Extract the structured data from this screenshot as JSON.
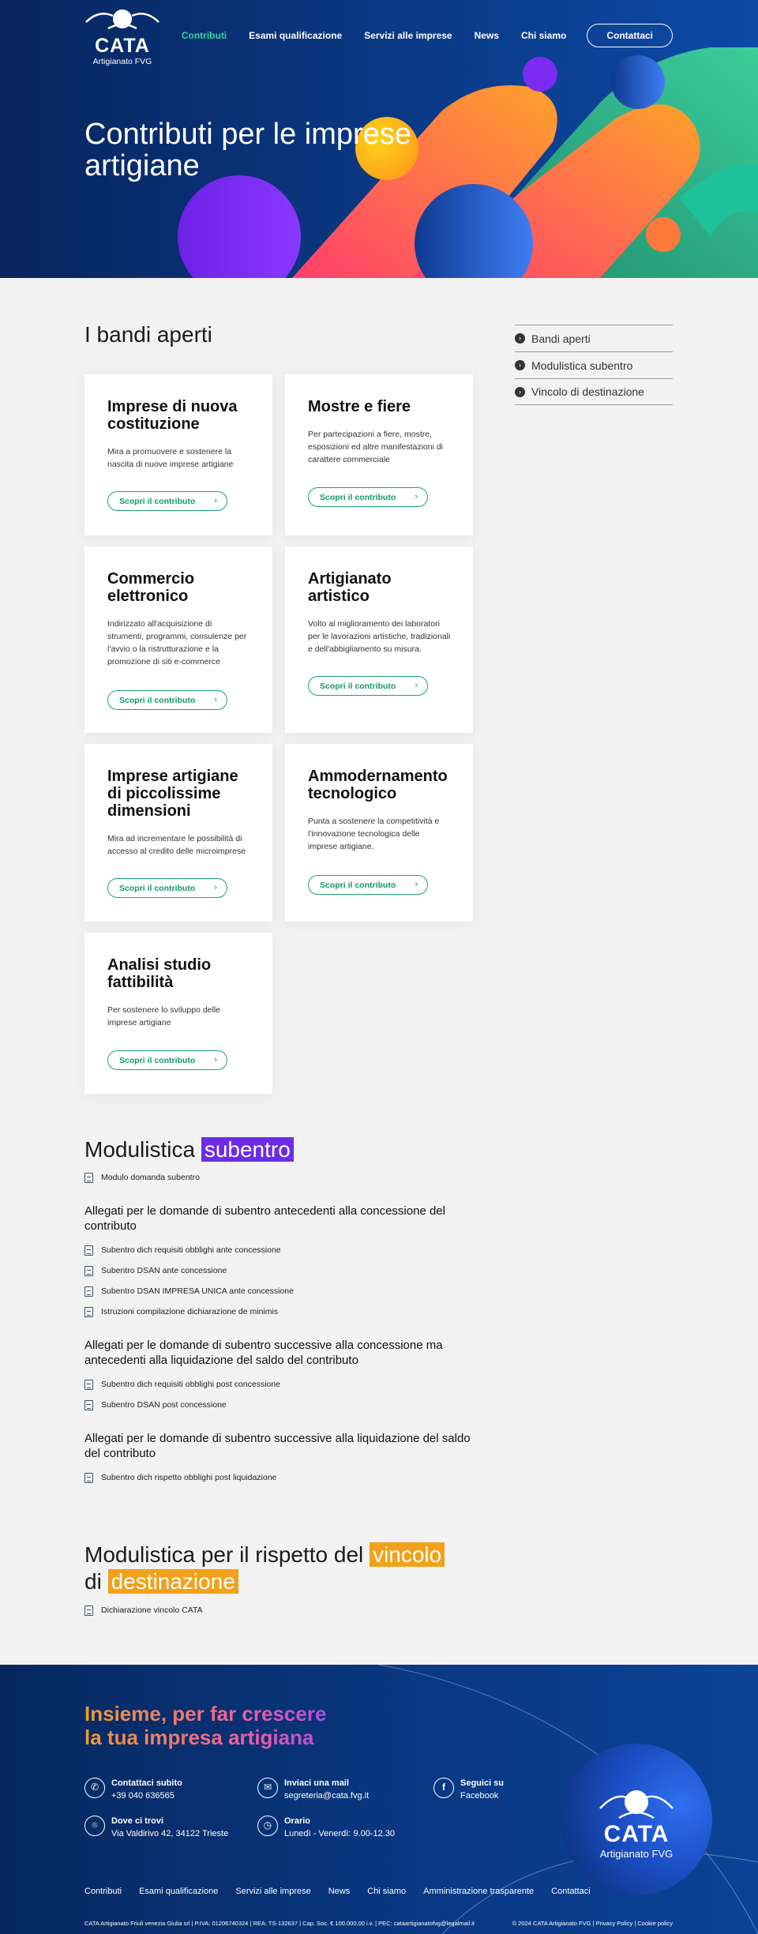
{
  "brand": {
    "name": "CATA",
    "sub": "Artigianato FVG"
  },
  "nav": {
    "items": [
      {
        "label": "Contributi"
      },
      {
        "label": "Esami qualificazione"
      },
      {
        "label": "Servizi alle imprese"
      },
      {
        "label": "News"
      },
      {
        "label": "Chi siamo"
      }
    ],
    "cta": "Contattaci",
    "accent": "#33d6a2"
  },
  "hero": {
    "title": "Contributi per le imprese artigiane"
  },
  "bandi": {
    "title": "I bandi aperti",
    "button": "Scopri il contributo",
    "cards": [
      {
        "title": "Imprese di nuova costituzione",
        "desc": "Mira a promuovere e sostenere la nascita di nuove imprese artigiane"
      },
      {
        "title": "Mostre e fiere",
        "desc": "Per partecipazioni a fiere, mostre, esposizioni ed altre manifestazioni di carattere commerciale"
      },
      {
        "title": "Commercio elettronico",
        "desc": "Indirizzato all'acquisizione di strumenti, programmi, consulenze per l'avvio o la ristrutturazione e la promozione di siti e-commerce"
      },
      {
        "title": "Artigianato artistico",
        "desc": "Volto al miglioramento dei laboratori per le lavorazioni artistiche, tradizionali e dell'abbigliamento su misura."
      },
      {
        "title": "Imprese artigiane di piccolissime dimensioni",
        "desc": "Mira ad incrementare le possibilità di accesso al credito delle microimprese"
      },
      {
        "title": "Ammodernamento tecnologico",
        "desc": "Punta a sostenere la competitività e l'innovazione tecnologica delle imprese artigiane."
      },
      {
        "title": "Analisi studio fattibilità",
        "desc": "Per sostenere lo sviluppo delle imprese artigiane"
      }
    ]
  },
  "sidebar": {
    "items": [
      {
        "label": "Bandi aperti"
      },
      {
        "label": "Modulistica subentro"
      },
      {
        "label": "Vincolo di destinazione"
      }
    ]
  },
  "subentro": {
    "title_a": "Modulistica",
    "title_hl": "subentro",
    "main_doc": "Modulo domanda subentro",
    "groups": [
      {
        "heading": "Allegati per le domande di subentro antecedenti alla concessione del contributo",
        "docs": [
          "Subentro dich requisiti obblighi ante concessione",
          "Subentro DSAN ante concessione",
          "Subentro DSAN IMPRESA UNICA ante concessione",
          "Istruzioni compilazione dichiarazione de minimis"
        ]
      },
      {
        "heading": "Allegati per le domande di subentro successive alla concessione ma antecedenti alla liquidazione del saldo del contributo",
        "docs": [
          "Subentro dich requisiti obblighi post concessione",
          "Subentro DSAN post concessione"
        ]
      },
      {
        "heading": "Allegati per le domande di subentro successive alla liquidazione del saldo del contributo",
        "docs": [
          "Subentro dich rispetto obblighi post liquidazione"
        ]
      }
    ]
  },
  "vincolo": {
    "title_a": "Modulistica per il rispetto del",
    "title_hl1": "vincolo",
    "title_b": "di",
    "title_hl2": "destinazione",
    "doc": "Dichiarazione vincolo CATA"
  },
  "footer": {
    "slogan_1": "Insieme, per far crescere",
    "slogan_2": "la tua impresa artigiana",
    "contacts": [
      {
        "label": "Contattaci subito",
        "value": "+39 040 636565",
        "icon": "phone-icon"
      },
      {
        "label": "Inviaci una mail",
        "value": "segreteria@cata.fvg.it",
        "icon": "mail-icon"
      },
      {
        "label": "Seguici su",
        "value": "Facebook",
        "icon": "facebook-icon"
      },
      {
        "label": "Dove ci trovi",
        "value": "Via Valdirivo 42, 34122 Trieste",
        "icon": "location-icon"
      },
      {
        "label": "Orario",
        "value": "Lunedì - Venerdì: 9.00-12.30",
        "icon": "clock-icon"
      }
    ],
    "links": [
      "Contributi",
      "Esami qualificazione",
      "Servizi alle imprese",
      "News",
      "Chi siamo",
      "Amministrazione trasparente",
      "Contattaci"
    ],
    "legal": "CATA Artigianato Friuli venezia Giulia srl | P.IVA: 01206740324 | REA: TS-132637 | Cap. Soc. € 100.000,00 i.v. | PEC: cataartigianatofvg@legalmail.it",
    "copyright": "© 2024 CATA Artigianato FVG",
    "privacy": "Privacy Policy",
    "cookie": "Cookie policy"
  }
}
